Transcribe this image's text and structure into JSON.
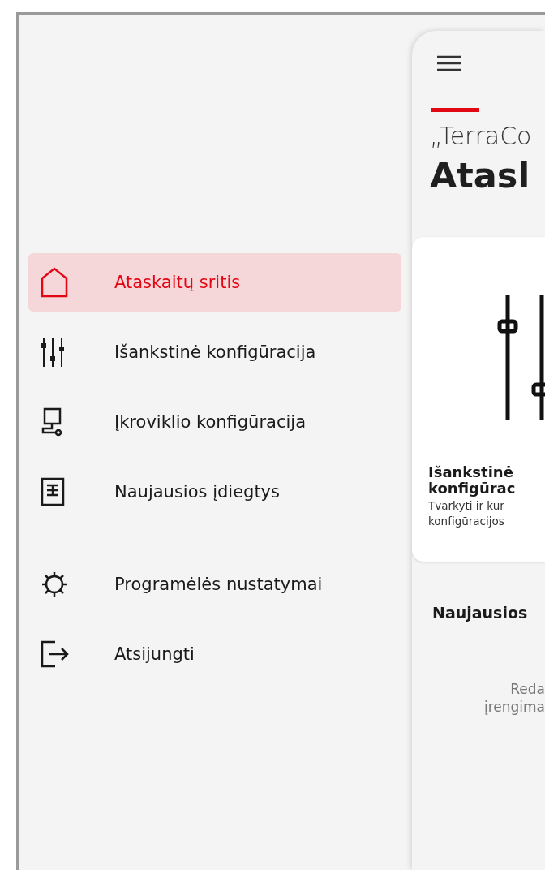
{
  "drawer": {
    "main_items": [
      {
        "label": "Ataskaitų sritis",
        "selected": true
      },
      {
        "label": "Išankstinė konfigūracija",
        "selected": false
      },
      {
        "label": "Įkroviklio konfigūracija",
        "selected": false
      },
      {
        "label": "Naujausios įdiegtys",
        "selected": false
      }
    ],
    "footer_items": [
      {
        "label": "Programėlės nustatymai",
        "selected": false
      },
      {
        "label": "Atsijungti",
        "selected": false
      }
    ]
  },
  "main": {
    "subtitle": "„TerraCo",
    "title": "Atasl",
    "card": {
      "title_lines": [
        "Išankstinė",
        "konfigūrac"
      ],
      "description_lines": [
        "Tvarkyti ir kur",
        "konfigūracijos"
      ]
    },
    "recent": {
      "heading": "Naujausios",
      "empty_lines": [
        "Reda",
        "įrengima"
      ]
    }
  }
}
